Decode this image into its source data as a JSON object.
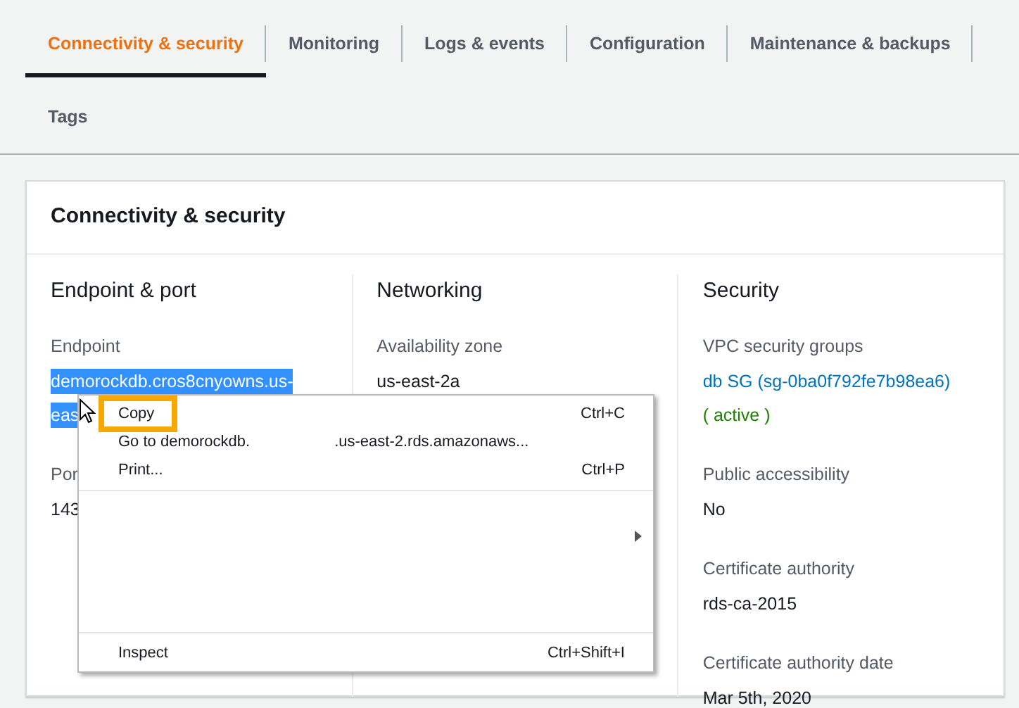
{
  "tabs": [
    {
      "label": "Connectivity & security",
      "selected": true
    },
    {
      "label": "Monitoring",
      "selected": false
    },
    {
      "label": "Logs & events",
      "selected": false
    },
    {
      "label": "Configuration",
      "selected": false
    },
    {
      "label": "Maintenance & backups",
      "selected": false
    },
    {
      "label": "Tags",
      "selected": false
    }
  ],
  "panel": {
    "title": "Connectivity & security",
    "columns": [
      {
        "heading": "Endpoint & port",
        "fields": [
          {
            "label": "Endpoint",
            "values": [
              {
                "kind": "selected",
                "text": "demorockdb.cros8cnyowns.us-"
              },
              {
                "kind": "selected",
                "text": "eas"
              }
            ]
          },
          {
            "label": "Por",
            "values": [
              {
                "kind": "plain",
                "text": "143"
              }
            ]
          }
        ]
      },
      {
        "heading": "Networking",
        "fields": [
          {
            "label": "Availability zone",
            "values": [
              {
                "kind": "plain",
                "text": "us-east-2a"
              }
            ]
          }
        ]
      },
      {
        "heading": "Security",
        "fields": [
          {
            "label": "VPC security groups",
            "values": [
              {
                "kind": "link",
                "text": "db SG (sg-0ba0f792fe7b98ea6)"
              },
              {
                "kind": "status",
                "text": "( active )"
              }
            ]
          },
          {
            "label": "Public accessibility",
            "values": [
              {
                "kind": "plain",
                "text": "No"
              }
            ]
          },
          {
            "label": "Certificate authority",
            "values": [
              {
                "kind": "plain",
                "text": "rds-ca-2015"
              }
            ]
          },
          {
            "label": "Certificate authority date",
            "values": [
              {
                "kind": "plain",
                "text": "Mar 5th, 2020"
              }
            ]
          }
        ]
      }
    ]
  },
  "context_menu": {
    "items": [
      {
        "kind": "command",
        "label": "Copy",
        "shortcut": "Ctrl+C",
        "highlighted": true
      },
      {
        "kind": "command",
        "label": "Go to demorockdb.",
        "detail": ".us-east-2.rds.amazonaws...",
        "highlighted": false
      },
      {
        "kind": "command",
        "label": "Print...",
        "shortcut": "Ctrl+P",
        "highlighted": false
      },
      {
        "kind": "separator"
      },
      {
        "kind": "submenu"
      },
      {
        "kind": "blank"
      },
      {
        "kind": "separator"
      },
      {
        "kind": "command",
        "label": "Inspect",
        "shortcut": "Ctrl+Shift+I",
        "highlighted": false
      }
    ]
  }
}
